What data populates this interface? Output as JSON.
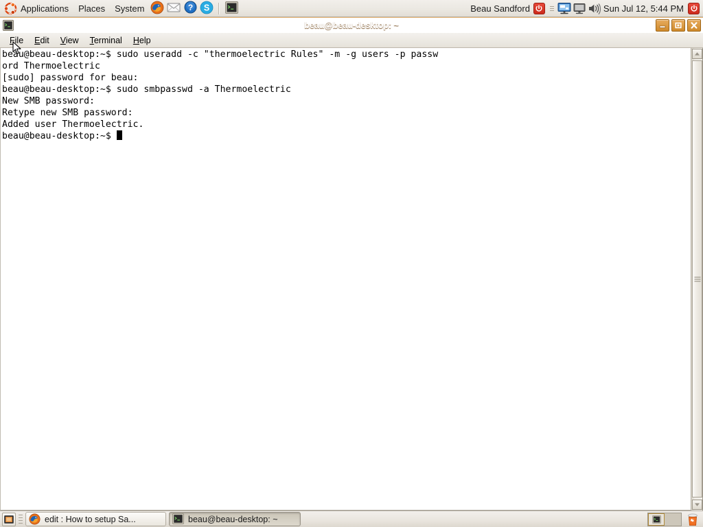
{
  "top_panel": {
    "menus": [
      {
        "label": "Applications",
        "icon": "ubuntu-logo-icon"
      },
      {
        "label": "Places",
        "icon": null
      },
      {
        "label": "System",
        "icon": null
      }
    ],
    "launchers": [
      {
        "name": "firefox-launcher",
        "title": "Firefox Web Browser"
      },
      {
        "name": "evolution-mail-launcher",
        "title": "Evolution Mail"
      },
      {
        "name": "help-launcher",
        "title": "Ubuntu Help Center"
      },
      {
        "name": "skype-launcher",
        "title": "Skype"
      },
      {
        "name": "terminal-launcher",
        "title": "Terminal"
      }
    ],
    "user_name": "Beau Sandford",
    "tray": [
      {
        "name": "network-monitor-icon"
      },
      {
        "name": "display-monitor-icon"
      },
      {
        "name": "volume-speaker-icon"
      }
    ],
    "clock": "Sun Jul 12,  5:44 PM",
    "shutdown_icon": "power-button-icon"
  },
  "window": {
    "title": "beau@beau-desktop: ~",
    "icon": "terminal-icon",
    "controls": {
      "minimize": "minimize-icon",
      "maximize": "maximize-icon",
      "close": "close-icon"
    },
    "menubar": [
      {
        "label": "File",
        "mnemonic": "F"
      },
      {
        "label": "Edit",
        "mnemonic": "E"
      },
      {
        "label": "View",
        "mnemonic": "V"
      },
      {
        "label": "Terminal",
        "mnemonic": "T"
      },
      {
        "label": "Help",
        "mnemonic": "H"
      }
    ]
  },
  "terminal": {
    "background": "#ffffff",
    "foreground": "#000000",
    "lines": [
      "beau@beau-desktop:~$ sudo useradd -c \"thermoelectric Rules\" -m -g users -p passw",
      "ord Thermoelectric",
      "[sudo] password for beau:",
      "beau@beau-desktop:~$ sudo smbpasswd -a Thermoelectric",
      "New SMB password:",
      "Retype new SMB password:",
      "Added user Thermoelectric.",
      "beau@beau-desktop:~$ "
    ],
    "text": "beau@beau-desktop:~$ sudo useradd -c \"thermoelectric Rules\" -m -g users -p passw\nord Thermoelectric\n[sudo] password for beau:\nbeau@beau-desktop:~$ sudo smbpasswd -a Thermoelectric\nNew SMB password:\nRetype new SMB password:\nAdded user Thermoelectric.\nbeau@beau-desktop:~$ ",
    "cursor": "block"
  },
  "bottom_panel": {
    "show_desktop": "show-desktop-icon",
    "tasks": [
      {
        "label": "edit : How to setup Sa...",
        "icon": "firefox-icon",
        "active": false
      },
      {
        "label": "beau@beau-desktop: ~",
        "icon": "terminal-icon",
        "active": true
      }
    ],
    "workspaces": [
      {
        "name": "workspace-1",
        "active": true
      },
      {
        "name": "workspace-2",
        "active": false
      }
    ],
    "trash": "trash-icon"
  },
  "colors": {
    "panel_bg": "#ece9e4",
    "titlebar_orange": "#d78f3b",
    "titlebar_dark": "#c2791c",
    "accent_red": "#cc2a1c",
    "trash_orange": "#f07023"
  }
}
